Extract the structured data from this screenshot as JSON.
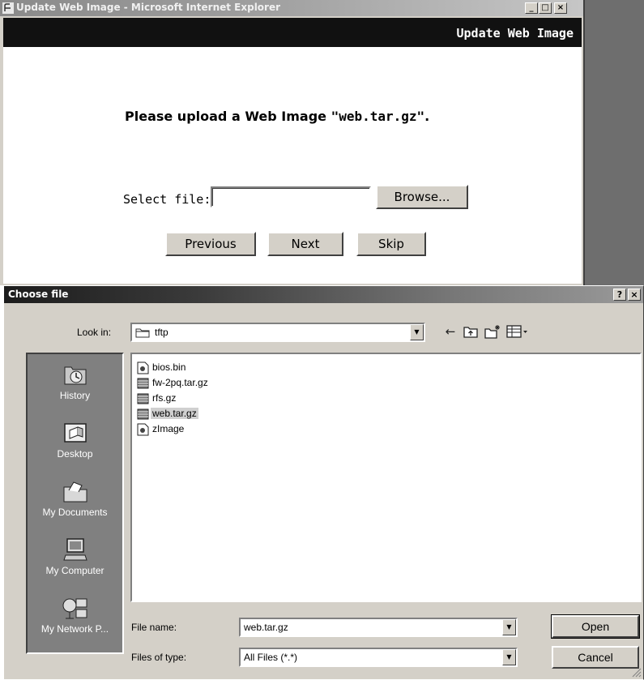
{
  "ie_window": {
    "title": "Update Web Image - Microsoft Internet Explorer",
    "controls": {
      "minimize": "_",
      "maximize": "□",
      "close": "×"
    },
    "header_title": "Update Web Image",
    "prompt_prefix": "Please upload a Web Image ",
    "prompt_filename": "\"web.tar.gz\"",
    "prompt_suffix": ".",
    "select_label": "Select file:",
    "file_input_value": "",
    "browse_label": "Browse...",
    "buttons": {
      "previous": "Previous",
      "next": "Next",
      "skip": "Skip"
    }
  },
  "dialog": {
    "title": "Choose file",
    "controls": {
      "help": "?",
      "close": "×"
    },
    "look_in_label": "Look in:",
    "look_in_value": "tftp",
    "places": [
      "History",
      "Desktop",
      "My Documents",
      "My Computer",
      "My Network P..."
    ],
    "files": [
      {
        "name": "bios.bin",
        "icon": "generic-file-icon"
      },
      {
        "name": "fw-2pq.tar.gz",
        "icon": "archive-icon"
      },
      {
        "name": "rfs.gz",
        "icon": "archive-icon"
      },
      {
        "name": "web.tar.gz",
        "icon": "archive-icon",
        "selected": true
      },
      {
        "name": "zImage",
        "icon": "generic-file-icon"
      }
    ],
    "file_name_label": "File name:",
    "file_name_value": "web.tar.gz",
    "file_type_label": "Files of type:",
    "file_type_value": "All Files (*.*)",
    "open_label": "Open",
    "cancel_label": "Cancel"
  }
}
